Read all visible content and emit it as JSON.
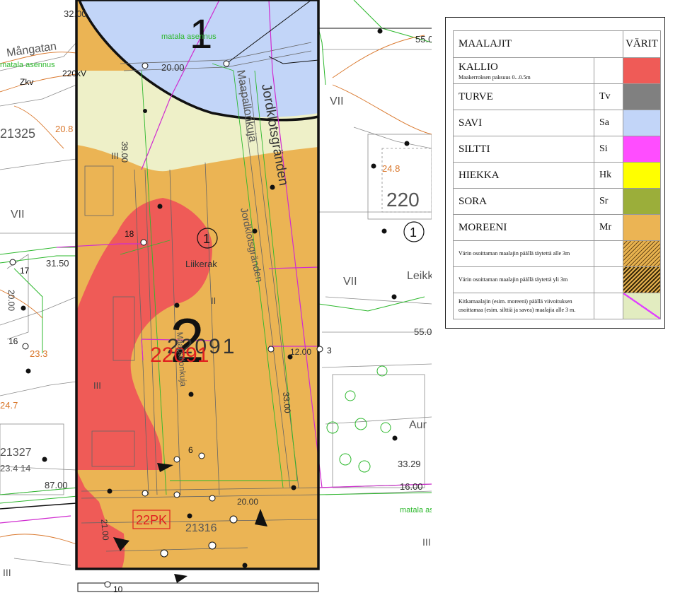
{
  "map": {
    "block_numbers": [
      "1",
      "2"
    ],
    "plot_circle_numbers": [
      "1",
      "1"
    ],
    "parcel_ids": [
      "22091",
      "22091",
      "21325",
      "21327",
      "21316",
      "220"
    ],
    "street_names": [
      "Jordklotsgränden",
      "Jordklotsgränden",
      "Maapallonkuja",
      "Maapallonkuja",
      "Liikerak",
      "Mångatan",
      "Leikk",
      "Aur"
    ],
    "roman_numerals": [
      "VII",
      "VII",
      "VII",
      "III",
      "III",
      "II",
      "III",
      "III"
    ],
    "dimensions": [
      "32.00",
      "31.50",
      "55.0",
      "55.0",
      "87.00",
      "16.00",
      "33.29",
      "20.00",
      "20.00",
      "12.00",
      "33.00",
      "21.00",
      "24.8",
      "24.7",
      "23.3",
      "20.8",
      "23.4 14",
      "20.00",
      "39.00",
      "18",
      "17",
      "16",
      "3",
      "6",
      "10",
      "Zkv",
      "220kV",
      "matala asennus",
      "matala asennus",
      "matala asennus"
    ],
    "red_label": "22091",
    "red_box_label": "22PK"
  },
  "legend": {
    "header_left": "MAALAJIT",
    "header_right": "VÄRIT",
    "rows": [
      {
        "name": "KALLIO",
        "sub": "Maakerroksen paksuus 0...0.5m",
        "abbr": "",
        "color": "#EF5B57"
      },
      {
        "name": "TURVE",
        "sub": "",
        "abbr": "Tv",
        "color": "#808080"
      },
      {
        "name": "SAVI",
        "sub": "",
        "abbr": "Sa",
        "color": "#C2D5F8"
      },
      {
        "name": "SILTTI",
        "sub": "",
        "abbr": "Si",
        "color": "#FF4DFF"
      },
      {
        "name": "HIEKKA",
        "sub": "",
        "abbr": "Hk",
        "color": "#FFFF00"
      },
      {
        "name": "SORA",
        "sub": "",
        "abbr": "Sr",
        "color": "#9BAE3A"
      },
      {
        "name": "MOREENI",
        "sub": "",
        "abbr": "Mr",
        "color": "#EBB454"
      }
    ],
    "notes": [
      "Värin osoittaman maalajin päällä täytettä alle 3m",
      "Värin osoittaman maalajin päällä täytettä yli 3m",
      "Kitkamaalajin (esim. moreeni) päällä viivoituksen osoittamaa (esim. silttiä ja savea) maalajia alle 3 m."
    ]
  },
  "colors": {
    "moraine": "#EBB454",
    "rock": "#EF5B57",
    "clay": "#C2D5F8",
    "light_fill": "#EEF0C8",
    "utility_green": "#2DB82D",
    "boundary_magenta": "#D02CD0",
    "contour_orange": "#D9762A"
  }
}
